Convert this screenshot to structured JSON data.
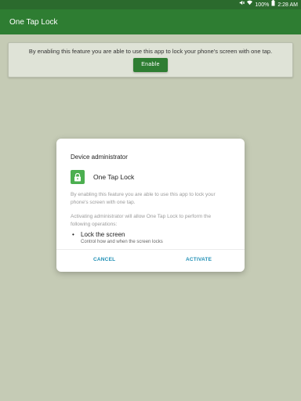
{
  "status_bar": {
    "battery": "100%",
    "time": "2:28 AM",
    "icons": [
      "mute-icon",
      "wifi-icon",
      "battery-icon"
    ]
  },
  "app_bar": {
    "title": "One Tap Lock"
  },
  "banner": {
    "text": "By enabling this feature you are able to use this app to lock your phone's screen with one tap.",
    "button_label": "Enable"
  },
  "dialog": {
    "title": "Device administrator",
    "app_name": "One Tap Lock",
    "app_icon": "lock-icon",
    "description": "By enabling this feature you are able to use this app to lock your phone's screen with one tap.",
    "warning": "Activating administrator will allow One Tap Lock to perform the following operations:",
    "policies": [
      {
        "title": "Lock the screen",
        "description": "Control how and when the screen locks"
      }
    ],
    "cancel_label": "CANCEL",
    "activate_label": "ACTIVATE"
  },
  "colors": {
    "primary": "#2e7d32",
    "status_bar": "#2b6a2d",
    "background": "#c5cbb5",
    "dialog_button": "#1f8fb5",
    "app_icon": "#4caf50"
  }
}
